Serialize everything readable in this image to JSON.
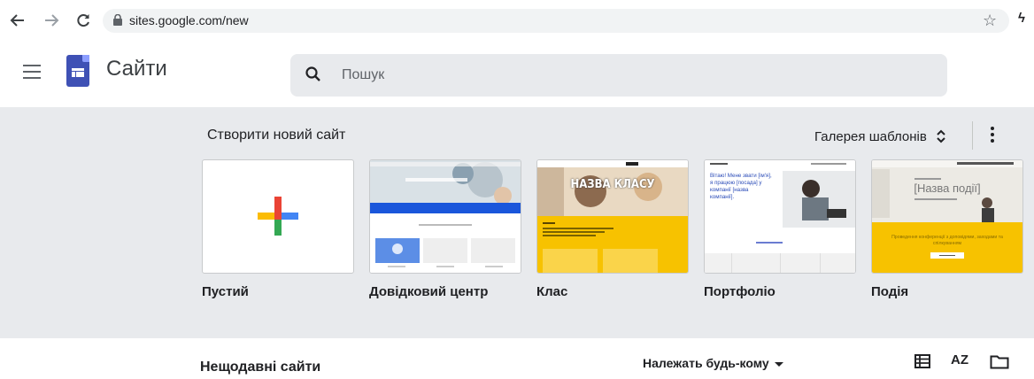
{
  "browser": {
    "url": "sites.google.com/new"
  },
  "app": {
    "title": "Сайти",
    "search_placeholder": "Пошук"
  },
  "templates": {
    "section_title": "Створити новий сайт",
    "gallery_label": "Галерея шаблонів",
    "items": [
      {
        "label": "Пустий"
      },
      {
        "label": "Довідковий центр"
      },
      {
        "label": "Клас",
        "hero_text": "НАЗВА КЛАСУ"
      },
      {
        "label": "Портфоліо",
        "hero_text": "Вітаю! Мене звати [ім'я], я працюю [посада] у компанії [назва компанії]."
      },
      {
        "label": "Подія",
        "hero_text": "[Назва події]",
        "cta_text": "Проведення конференції з доповідями, заходами та спілкуванням"
      }
    ]
  },
  "recent": {
    "title": "Нещодавні сайти",
    "owner_filter": "Належать будь-кому",
    "sort_label": "AZ"
  },
  "colors": {
    "band_bg": "#e8eaed",
    "logo_blue": "#3f51b5",
    "template_yellow": "#f7c200",
    "help_blue": "#1a56db"
  },
  "icons": [
    "back-arrow-icon",
    "forward-arrow-icon",
    "reload-icon",
    "lock-icon",
    "star-icon",
    "extension-icon",
    "menu-icon",
    "sites-logo-icon",
    "search-icon",
    "unfold-icon",
    "more-vert-icon",
    "plus-icon",
    "list-view-icon",
    "sort-az-icon",
    "folder-icon"
  ]
}
